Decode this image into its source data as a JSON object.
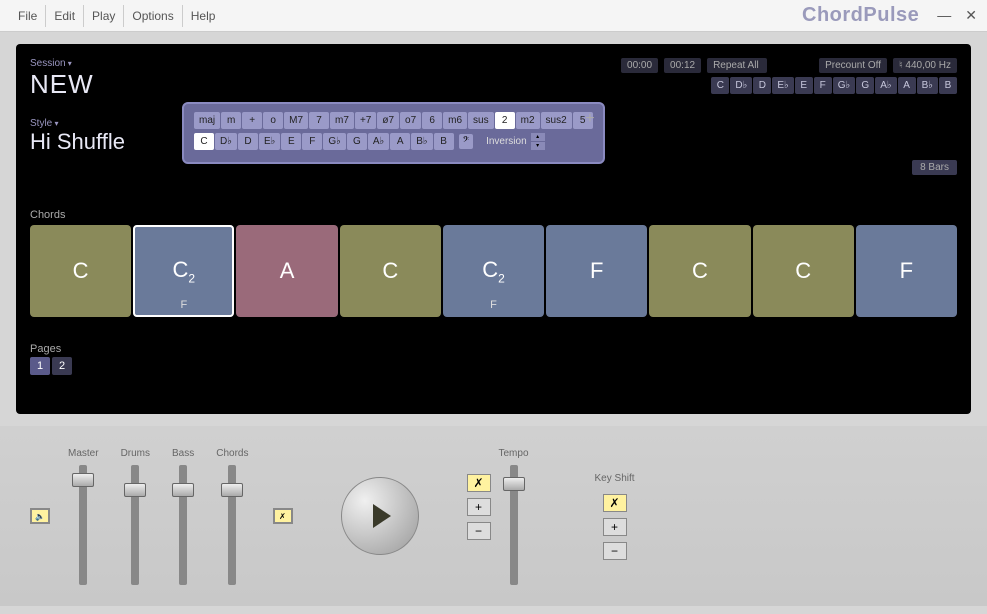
{
  "menubar": {
    "items": [
      "File",
      "Edit",
      "Play",
      "Options",
      "Help"
    ],
    "brand": "ChordPulse"
  },
  "session": {
    "label": "Session",
    "name": "NEW"
  },
  "transport": {
    "time_current": "00:00",
    "time_total": "00:12",
    "repeat": "Repeat All",
    "precount": "Precount Off",
    "tuning": "♮ 440,00 Hz"
  },
  "key_palette": [
    "C",
    "D♭",
    "D",
    "E♭",
    "E",
    "F",
    "G♭",
    "G",
    "A♭",
    "A",
    "B♭",
    "B"
  ],
  "style": {
    "label": "Style",
    "name": "Hi Shuffle"
  },
  "picker": {
    "quality_row": [
      "maj",
      "m",
      "+",
      "o",
      "M7",
      "7",
      "m7",
      "+7",
      "ø7",
      "o7",
      "6",
      "m6",
      "sus",
      "2",
      "m2",
      "sus2",
      "5"
    ],
    "active_quality_index": 13,
    "root_row": [
      "C",
      "D♭",
      "D",
      "E♭",
      "E",
      "F",
      "G♭",
      "G",
      "A♭",
      "A",
      "B♭",
      "B"
    ],
    "active_root_index": 0,
    "inversion_label": "Inversion",
    "clef": "𝄢"
  },
  "bars_badge": "8 Bars",
  "chords": {
    "label": "Chords",
    "slots": [
      {
        "label": "C",
        "sub": "",
        "bass": "",
        "color": "olive",
        "selected": false
      },
      {
        "label": "C",
        "sub": "2",
        "bass": "F",
        "color": "blue",
        "selected": true
      },
      {
        "label": "A",
        "sub": "",
        "bass": "",
        "color": "red",
        "selected": false
      },
      {
        "label": "C",
        "sub": "",
        "bass": "",
        "color": "olive",
        "selected": false
      },
      {
        "label": "C",
        "sub": "2",
        "bass": "F",
        "color": "blue",
        "selected": false
      },
      {
        "label": "F",
        "sub": "",
        "bass": "",
        "color": "blue",
        "selected": false
      },
      {
        "label": "C",
        "sub": "",
        "bass": "",
        "color": "olive",
        "selected": false
      },
      {
        "label": "C",
        "sub": "",
        "bass": "",
        "color": "olive",
        "selected": false
      },
      {
        "label": "F",
        "sub": "",
        "bass": "",
        "color": "blue",
        "selected": false
      }
    ]
  },
  "pages": {
    "label": "Pages",
    "items": [
      "1",
      "2"
    ],
    "active_index": 0
  },
  "faders": {
    "master": {
      "label": "Master",
      "pos": 8
    },
    "drums": {
      "label": "Drums",
      "pos": 18
    },
    "bass": {
      "label": "Bass",
      "pos": 18
    },
    "chords": {
      "label": "Chords",
      "pos": 18
    },
    "tempo": {
      "label": "Tempo",
      "pos": 12
    }
  },
  "keyshift": {
    "label": "Key Shift"
  },
  "icons": {
    "speaker": "🔈",
    "reset": "✗",
    "plus": "+",
    "minus": "−",
    "up": "▴",
    "down": "▾",
    "minimize": "—",
    "close": "✕"
  }
}
